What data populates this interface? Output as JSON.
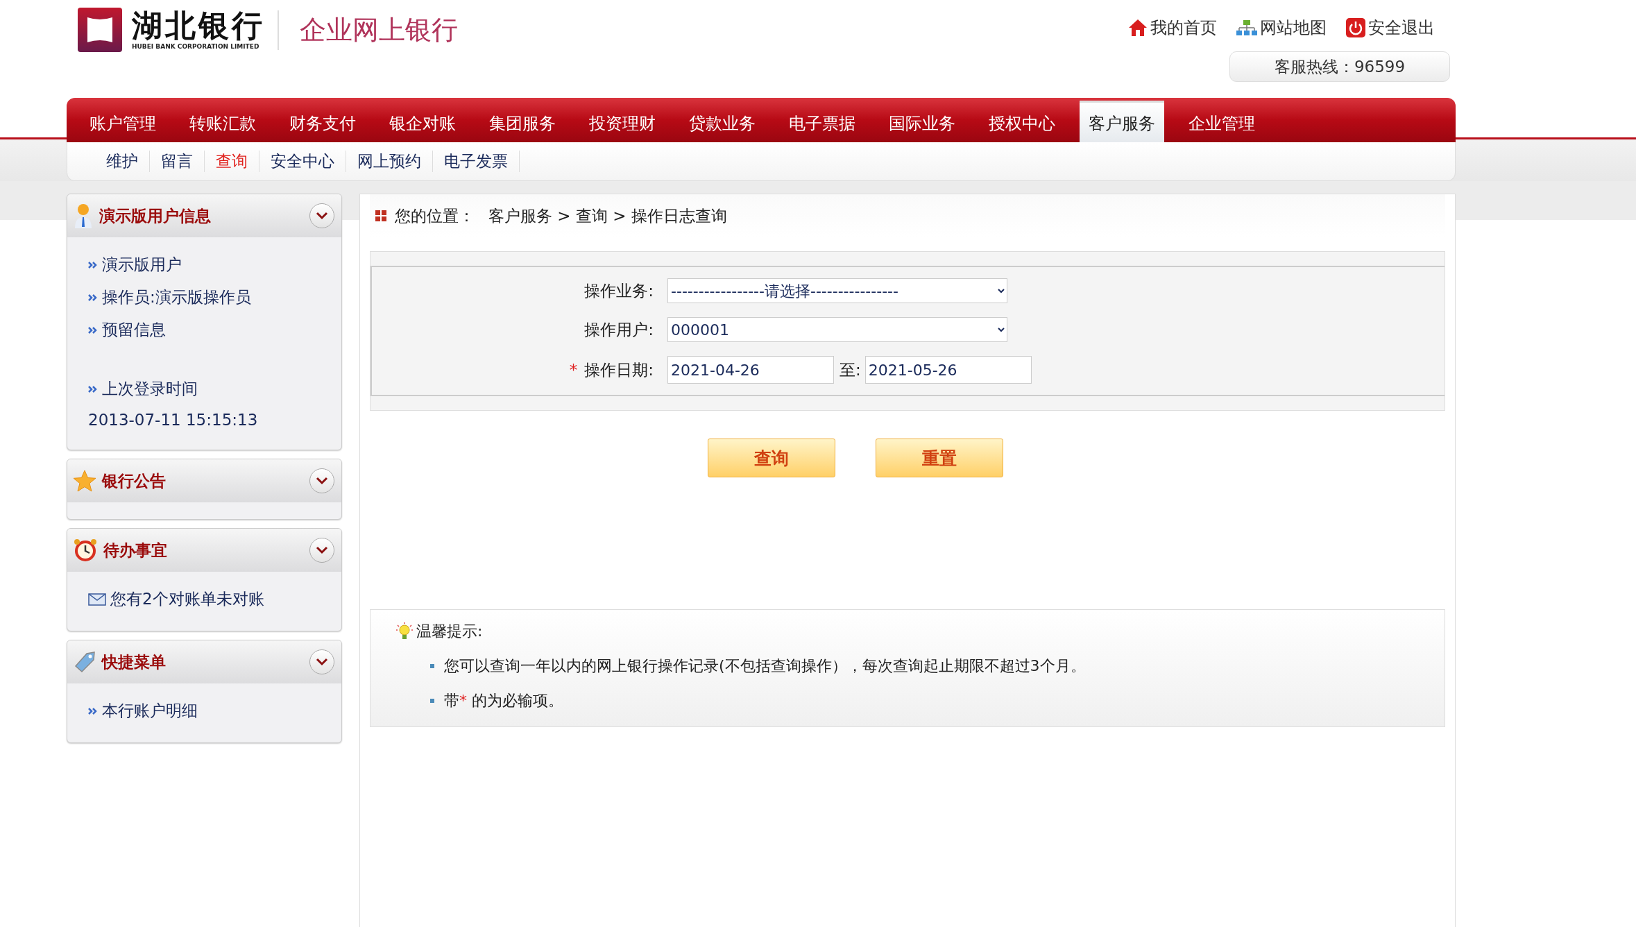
{
  "header": {
    "bank_name": "湖北银行",
    "bank_name_en": "HUBEI BANK CORPORATION LIMITED",
    "product": "企业网上银行",
    "top_links": [
      {
        "kind": "home",
        "label": "我的首页"
      },
      {
        "kind": "sitemap",
        "label": "网站地图"
      },
      {
        "kind": "logout",
        "label": "安全退出"
      }
    ],
    "hotline": "客服热线：96599"
  },
  "main_nav": [
    {
      "label": "账户管理",
      "selected": false
    },
    {
      "label": "转账汇款",
      "selected": false
    },
    {
      "label": "财务支付",
      "selected": false
    },
    {
      "label": "银企对账",
      "selected": false
    },
    {
      "label": "集团服务",
      "selected": false
    },
    {
      "label": "投资理财",
      "selected": false
    },
    {
      "label": "贷款业务",
      "selected": false
    },
    {
      "label": "电子票据",
      "selected": false
    },
    {
      "label": "国际业务",
      "selected": false
    },
    {
      "label": "授权中心",
      "selected": false
    },
    {
      "label": "客户服务",
      "selected": true
    },
    {
      "label": "企业管理",
      "selected": false
    }
  ],
  "sub_nav": [
    {
      "label": "维护",
      "selected": false
    },
    {
      "label": "留言",
      "selected": false
    },
    {
      "label": "查询",
      "selected": true
    },
    {
      "label": "安全中心",
      "selected": false
    },
    {
      "label": "网上预约",
      "selected": false
    },
    {
      "label": "电子发票",
      "selected": false
    }
  ],
  "sidebar": [
    {
      "kind": "user",
      "title": "演示版用户信息",
      "items": [
        {
          "kind": "link",
          "label": "演示版用户"
        },
        {
          "kind": "link",
          "label": "操作员:演示版操作员"
        },
        {
          "kind": "link",
          "label": "预留信息"
        },
        {
          "kind": "info",
          "label": "上次登录时间",
          "value": "2013-07-11 15:15:13"
        }
      ]
    },
    {
      "kind": "notice",
      "title": "银行公告"
    },
    {
      "kind": "todo",
      "title": "待办事宜",
      "items": [
        {
          "kind": "message",
          "label": "您有2个对账单未对账"
        }
      ]
    },
    {
      "kind": "shortcut",
      "title": "快捷菜单",
      "items": [
        {
          "kind": "link",
          "label": "本行账户明细"
        }
      ]
    }
  ],
  "breadcrumb": {
    "label": "您的位置：",
    "path": "客户服务 > 查询 > 操作日志查询"
  },
  "form": [
    {
      "kind": "select",
      "label": "操作业务:",
      "required": false,
      "value": "-----------------请选择----------------"
    },
    {
      "kind": "select",
      "label": "操作用户:",
      "required": false,
      "value": "000001"
    },
    {
      "kind": "daterange",
      "label": "操作日期:",
      "required": true,
      "from": "2021-04-26",
      "separator": "至:",
      "to": "2021-05-26"
    }
  ],
  "required_mark": "*",
  "buttons": [
    "查询",
    "重置"
  ],
  "tips": {
    "title": "温馨提示:",
    "items": [
      {
        "kind": "plain",
        "text": "您可以查询一年以内的网上银行操作记录(不包括查询操作），每次查询起止期限不超过3个月。"
      },
      {
        "kind": "required",
        "before": "带",
        "after": " 的为必输项。"
      }
    ]
  }
}
